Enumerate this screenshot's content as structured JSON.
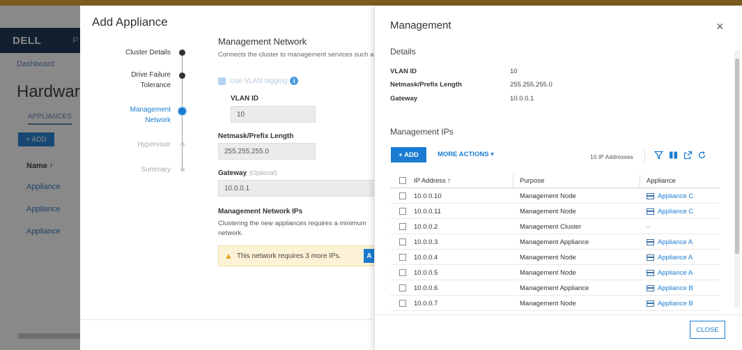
{
  "background_app": {
    "logo": "DELL",
    "header_extra": "P",
    "breadcrumb": "Dashboard",
    "page_title": "Hardware",
    "tab": "APPLIANCES",
    "add_label": "+ ADD",
    "column_name": "Name ↑",
    "rows": [
      "Appliance",
      "Appliance",
      "Appliance"
    ]
  },
  "modal": {
    "title": "Add Appliance",
    "steps": [
      "Cluster Details",
      "Drive Failure\nTolerance",
      "Management\nNetwork",
      "Hypervisor",
      "Summary"
    ],
    "active_step": 2,
    "form": {
      "title": "Management Network",
      "description": "Connects the cluster to management services such as",
      "vlan_tagging_label": "Use VLAN tagging",
      "vlan_id_label": "VLAN ID",
      "vlan_id_value": "10",
      "netmask_label": "Netmask/Prefix Length",
      "netmask_value": "255.255.255.0",
      "gateway_label": "Gateway",
      "gateway_optional": "(Optional)",
      "gateway_value": "10.0.0.1",
      "ips_title": "Management Network IPs",
      "ips_desc_line1": "Clustering the new appliances requires a minimum",
      "ips_desc_line2": "network.",
      "warning": "This network requires 3 more IPs.",
      "warning_button": "A"
    }
  },
  "panel": {
    "title": "Management",
    "close_icon": "×",
    "details_title": "Details",
    "details": [
      {
        "key": "VLAN ID",
        "value": "10"
      },
      {
        "key": "Netmask/Prefix Length",
        "value": "255.255.255.0"
      },
      {
        "key": "Gateway",
        "value": "10.0.0.1"
      }
    ],
    "ips_title": "Management IPs",
    "add_label": "+ ADD",
    "more_actions_label": "MORE ACTIONS ▾",
    "ip_count": "10 IP Addresses",
    "columns": [
      "IP Address ↑",
      "Purpose",
      "Appliance"
    ],
    "rows": [
      {
        "ip": "10.0.0.10",
        "purpose": "Management Node",
        "appliance": "Appliance C"
      },
      {
        "ip": "10.0.0.11",
        "purpose": "Management Node",
        "appliance": "Appliance C"
      },
      {
        "ip": "10.0.0.2",
        "purpose": "Management Cluster",
        "appliance": "–"
      },
      {
        "ip": "10.0.0.3",
        "purpose": "Management Appliance",
        "appliance": "Appliance A"
      },
      {
        "ip": "10.0.0.4",
        "purpose": "Management Node",
        "appliance": "Appliance A"
      },
      {
        "ip": "10.0.0.5",
        "purpose": "Management Node",
        "appliance": "Appliance A"
      },
      {
        "ip": "10.0.0.6",
        "purpose": "Management Appliance",
        "appliance": "Appliance B"
      },
      {
        "ip": "10.0.0.7",
        "purpose": "Management Node",
        "appliance": "Appliance B"
      }
    ],
    "close_button": "CLOSE",
    "accent_color": "#1a7bd1"
  }
}
